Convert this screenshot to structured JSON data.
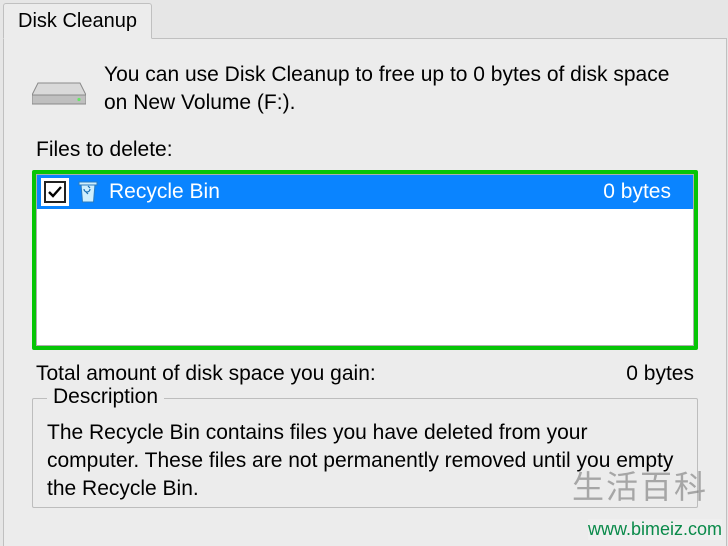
{
  "tab": {
    "label": "Disk Cleanup"
  },
  "intro": {
    "text": "You can use Disk Cleanup to free up to 0 bytes of disk space on New Volume (F:)."
  },
  "files_label": "Files to delete:",
  "items": [
    {
      "label": "Recycle Bin",
      "size": "0 bytes",
      "checked": true,
      "selected": true
    }
  ],
  "total": {
    "label": "Total amount of disk space you gain:",
    "value": "0 bytes"
  },
  "description": {
    "legend": "Description",
    "text": "The Recycle Bin contains files you have deleted from your computer. These files are not permanently removed until you empty the Recycle Bin."
  },
  "watermark": {
    "brand": "生活百科",
    "url": "www.bimeiz.com"
  }
}
